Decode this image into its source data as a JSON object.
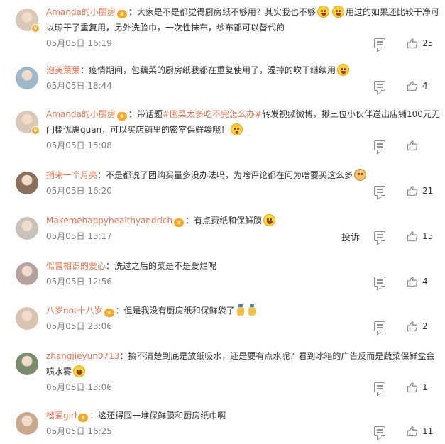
{
  "comments": [
    {
      "user": "Amanda的小厨房",
      "badge": "会员",
      "verified": true,
      "segments": [
        {
          "t": "：大家是不是都觉得厨房纸不够用？其实我也不够"
        },
        {
          "e": "laugh"
        },
        {
          "e": "laugh"
        },
        {
          "t": "用过的如果还比较干净可以晾干了重复用，另外洗脸巾，一次性抹布，纱布都可以替代的"
        }
      ],
      "time": "05月05日 16:19",
      "likes": "25"
    },
    {
      "user": "泡芙葉葉",
      "segments": [
        {
          "t": "：疫情期间，包藕菜的厨房纸我都在重复使用了，湿掉的吹干继续用"
        },
        {
          "e": "laugh"
        }
      ],
      "time": "05月05日 18:44",
      "likes": "4"
    },
    {
      "user": "Amanda的小厨房",
      "badge": "会员",
      "verified": true,
      "segments": [
        {
          "t": "：带话题"
        },
        {
          "topic": "#囤菜太多吃不完怎么办#"
        },
        {
          "t": "转发视频微博，揪三位小伙伴送出店铺100元无门槛优惠quan，可以买店铺里的密室保鲜袋哦！"
        },
        {
          "e": "shock"
        }
      ],
      "time": "05月05日 15:08",
      "likes": ""
    },
    {
      "user": "捎来一个月亮",
      "segments": [
        {
          "t": "：不是都说了团购买量多没办法吗，为啥评论都在问为啥要买这么多"
        },
        {
          "e": "dog"
        }
      ],
      "time": "05月05日 16:20",
      "likes": "21"
    },
    {
      "user": "Makemehappyhealthyandrich",
      "badge": "会员",
      "segments": [
        {
          "t": "：有点费纸和保鲜膜"
        },
        {
          "e": "laugh"
        }
      ],
      "time": "05月05日 13:17",
      "report": "投诉",
      "likes": "15"
    },
    {
      "user": "似曾相识的爱心",
      "segments": [
        {
          "t": "：洗过之后的菜是不是爱烂呢"
        }
      ],
      "time": "05月05日 12:56",
      "likes": "4"
    },
    {
      "user": "八岁not十八岁",
      "badge": "会员",
      "segments": [
        {
          "t": "：但是我没有厨房纸和保鲜袋了"
        },
        {
          "e": "bottle"
        },
        {
          "e": "bottle"
        }
      ],
      "time": "05月05日 23:06",
      "likes": "2"
    },
    {
      "user": "zhangjieyun0713",
      "segments": [
        {
          "t": "：搞不清楚到底是放纸吸水，还是要有点水呢？看到冰箱的广告反而是蔬菜保鲜盒会喷水雾"
        },
        {
          "e": "laugh"
        }
      ],
      "time": "05月05日 13:06",
      "likes": "1"
    },
    {
      "user": "楷爱girl",
      "badge": "会员",
      "segments": [
        {
          "t": "：这还得囤一堆保鲜膜和厨房纸巾啊"
        }
      ],
      "time": "05月05日 16:25",
      "likes": "11"
    }
  ],
  "colors": {
    "username": "#eb7350",
    "text": "#333333",
    "time": "#808080",
    "icon": "#8f8f8f"
  }
}
